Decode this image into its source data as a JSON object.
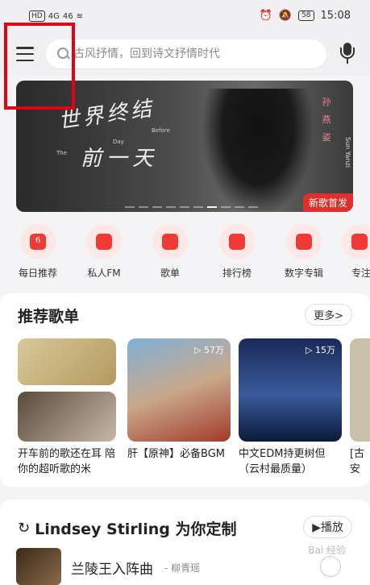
{
  "status_bar": {
    "left_tags": [
      "HD",
      "4G",
      "46"
    ],
    "time": "15:08",
    "battery": "58"
  },
  "search": {
    "placeholder": "古风抒情，回到诗文抒情时代"
  },
  "banner": {
    "title_line1": "世界终结",
    "title_line2": "前一天",
    "small_text_1": "The",
    "small_text_2": "Day",
    "small_text_3": "Before",
    "artist_cn": "孙燕姿",
    "artist_en": "Sun Yanzi",
    "badge": "新歌首发"
  },
  "categories": [
    {
      "label": "每日推荐",
      "icon": "calendar-icon"
    },
    {
      "label": "私人FM",
      "icon": "radio-icon"
    },
    {
      "label": "歌单",
      "icon": "playlist-icon"
    },
    {
      "label": "排行榜",
      "icon": "chart-icon"
    },
    {
      "label": "数字专辑",
      "icon": "album-icon"
    },
    {
      "label": "专注",
      "icon": "heart-icon"
    }
  ],
  "daily_day": "6",
  "recommended": {
    "title": "推荐歌单",
    "more_label": "更多>",
    "playlists": [
      {
        "name": "开车前的歌还在耳 陪你的超听歌的米",
        "plays": ""
      },
      {
        "name": "肝【原神】必备BGM",
        "plays": "57万"
      },
      {
        "name": "中文EDM持更树但（云村最质量）",
        "plays": "15万"
      },
      {
        "name": "[古 安",
        "plays": ""
      }
    ]
  },
  "custom": {
    "title": "Lindsey Stirling 为你定制",
    "play_label": "▶播放",
    "song_title": "兰陵王入阵曲",
    "song_artist": "- 柳青瑶"
  },
  "watermark": "Bai 经验"
}
